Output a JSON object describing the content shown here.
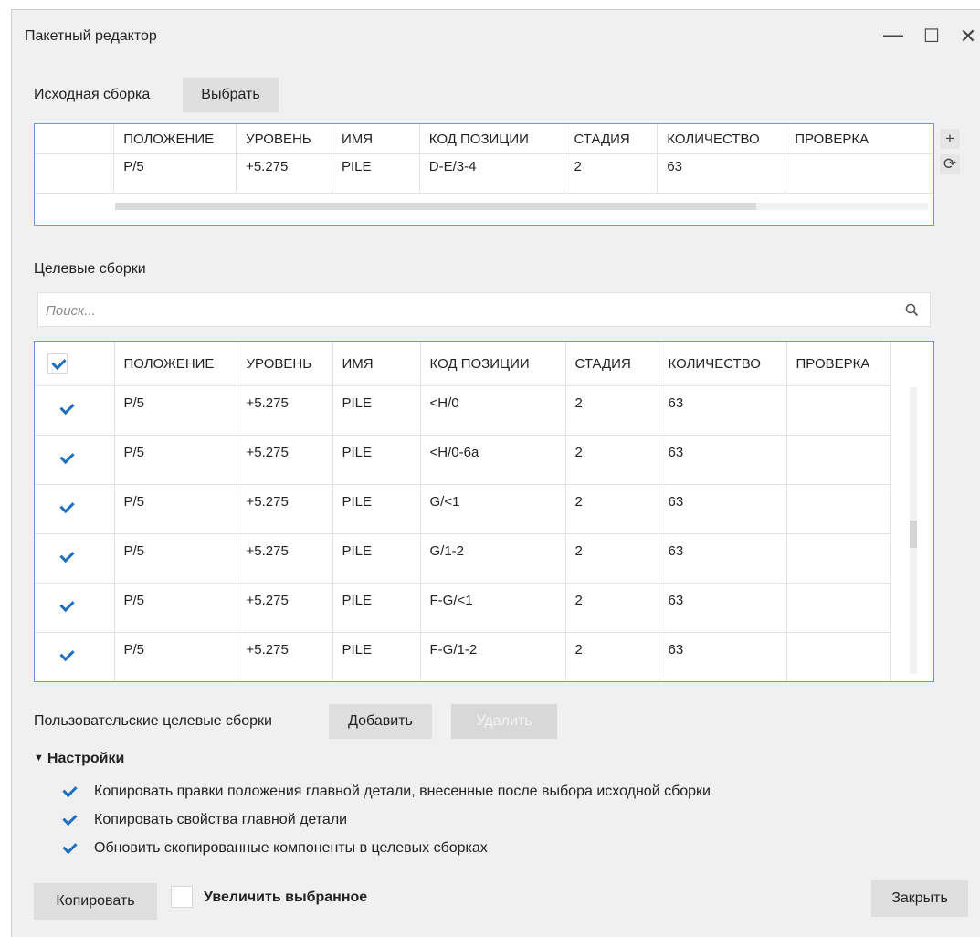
{
  "window": {
    "title": "Пакетный редактор",
    "controls": [
      "—",
      "☐",
      "✕"
    ]
  },
  "source": {
    "label": "Исходная сборка",
    "select_button": "Выбрать",
    "columns": [
      "ПОЛОЖЕНИЕ",
      "УРОВЕНЬ",
      "ИМЯ",
      "КОД ПОЗИЦИИ",
      "СТАДИЯ",
      "КОЛИЧЕСТВО",
      "ПРОВЕРКА"
    ],
    "row": [
      "P/5",
      "+5.275",
      "PILE",
      "D-E/3-4",
      "2",
      "63",
      ""
    ],
    "side_buttons": [
      "+",
      "⟳"
    ]
  },
  "targets": {
    "label": "Целевые сборки",
    "search_placeholder": "Поиск...",
    "search_icon": "magnifier-icon",
    "columns": [
      "ПОЛОЖЕНИЕ",
      "УРОВЕНЬ",
      "ИМЯ",
      "КОД ПОЗИЦИИ",
      "СТАДИЯ",
      "КОЛИЧЕСТВО",
      "ПРОВЕРКА"
    ],
    "rows": [
      {
        "checked": true,
        "cells": [
          "P/5",
          "+5.275",
          "PILE",
          "<H/0",
          "2",
          "63",
          ""
        ]
      },
      {
        "checked": true,
        "cells": [
          "P/5",
          "+5.275",
          "PILE",
          "<H/0-6a",
          "2",
          "63",
          ""
        ]
      },
      {
        "checked": true,
        "cells": [
          "P/5",
          "+5.275",
          "PILE",
          "G/<1",
          "2",
          "63",
          ""
        ]
      },
      {
        "checked": true,
        "cells": [
          "P/5",
          "+5.275",
          "PILE",
          "G/1-2",
          "2",
          "63",
          ""
        ]
      },
      {
        "checked": true,
        "cells": [
          "P/5",
          "+5.275",
          "PILE",
          "F-G/<1",
          "2",
          "63",
          ""
        ]
      },
      {
        "checked": true,
        "cells": [
          "P/5",
          "+5.275",
          "PILE",
          "F-G/1-2",
          "2",
          "63",
          ""
        ]
      }
    ]
  },
  "custom": {
    "label": "Пользовательские целевые сборки",
    "add_button": "Добавить",
    "remove_button": "Удалить"
  },
  "settings": {
    "header": "Настройки",
    "options": [
      {
        "label": "Копировать правки положения главной детали, внесенные после выбора исходной сборки",
        "checked": true
      },
      {
        "label": "Копировать свойства главной детали",
        "checked": true
      },
      {
        "label": "Обновить скопированные компоненты в целевых сборках",
        "checked": true
      }
    ]
  },
  "footer": {
    "copy_button": "Копировать",
    "zoom_label": "Увеличить выбранное",
    "zoom_checked": false,
    "close_button": "Закрыть"
  },
  "colors": {
    "accent": "#1f6fbf",
    "grid_border": "#6a9bd1",
    "button": "#dedede"
  }
}
